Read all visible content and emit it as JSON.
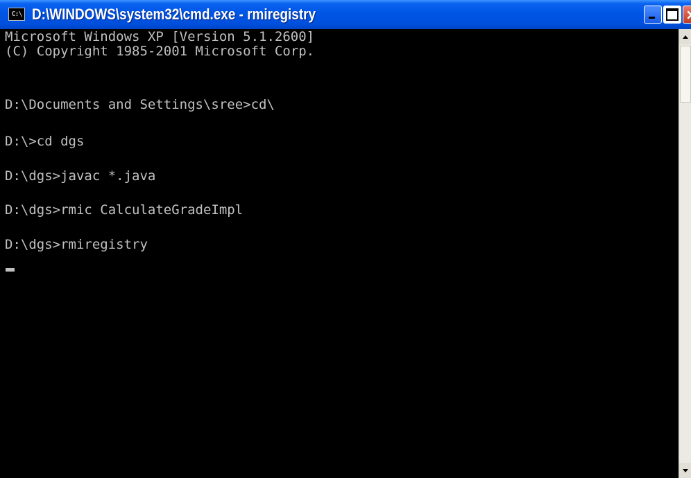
{
  "window": {
    "title": "D:\\WINDOWS\\system32\\cmd.exe - rmiregistry",
    "system_icon_text": "C:\\",
    "controls": {
      "minimize": "minimize",
      "maximize": "maximize",
      "close": "×"
    }
  },
  "console": {
    "lines": [
      "Microsoft Windows XP [Version 5.1.2600]",
      "(C) Copyright 1985-2001 Microsoft Corp.",
      "",
      "D:\\Documents and Settings\\sree>cd\\",
      "",
      "D:\\>cd dgs",
      "",
      "D:\\dgs>javac *.java",
      "",
      "D:\\dgs>rmic CalculateGradeImpl",
      "",
      "D:\\dgs>rmiregistry"
    ],
    "colors": {
      "background": "#000000",
      "foreground": "#c0c0c0"
    }
  },
  "icons": {
    "system": "console-app-icon",
    "minimize": "minimize-icon",
    "maximize": "maximize-icon",
    "close": "close-icon",
    "scroll_up": "scroll-up-arrow-icon",
    "scroll_down": "scroll-down-arrow-icon"
  }
}
